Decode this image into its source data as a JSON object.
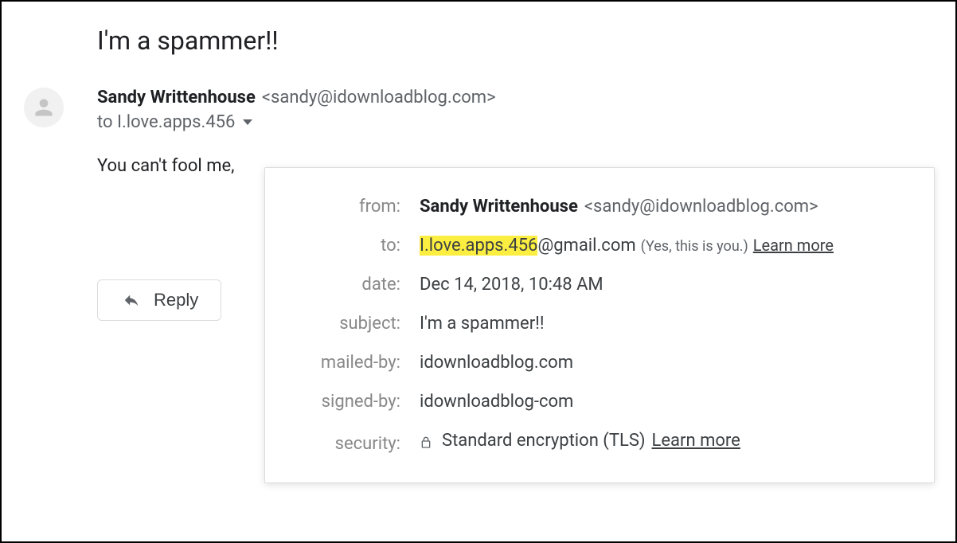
{
  "subject": "I'm a spammer!!",
  "sender": {
    "name": "Sandy Writtenhouse",
    "email": "<sandy@idownloadblog.com>"
  },
  "to_line": "to I.love.apps.456",
  "body_text": "You can't fool me,",
  "reply_label": "Reply",
  "details": {
    "from_label": "from:",
    "from_name": "Sandy Writtenhouse",
    "from_email": "<sandy@idownloadblog.com>",
    "to_label": "to:",
    "to_highlight": "I.love.apps.456",
    "to_rest": "@gmail.com",
    "to_note": "(Yes, this is you.)",
    "to_learn_more": "Learn more",
    "date_label": "date:",
    "date_value": "Dec 14, 2018, 10:48 AM",
    "subject_label": "subject:",
    "subject_value": "I'm a spammer!!",
    "mailed_by_label": "mailed-by:",
    "mailed_by_value": "idownloadblog.com",
    "signed_by_label": "signed-by:",
    "signed_by_value": "idownloadblog-com",
    "security_label": "security:",
    "security_value": "Standard encryption (TLS)",
    "security_learn_more": "Learn more"
  }
}
